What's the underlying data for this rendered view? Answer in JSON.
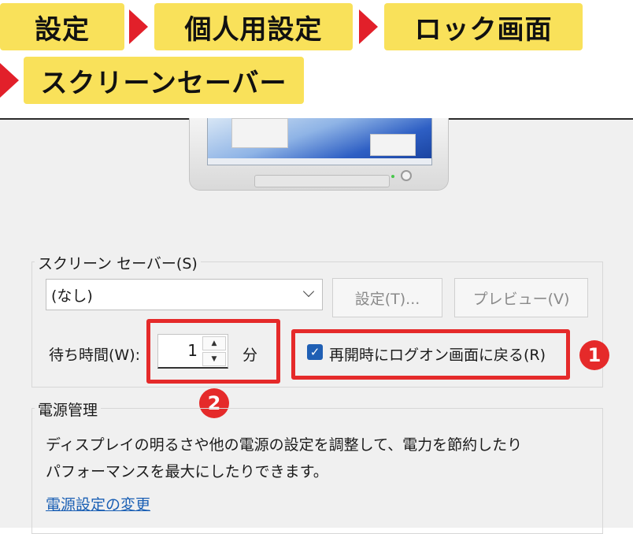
{
  "breadcrumb": {
    "items": [
      "設定",
      "個人用設定",
      "ロック画面",
      "スクリーンセーバー"
    ]
  },
  "colors": {
    "banner": "#f9e15a",
    "arrow": "#e2202a",
    "highlight": "#e52a2a",
    "checkbox": "#1f5fb4",
    "link": "#1a5fb4"
  },
  "screensaver": {
    "legend": "スクリーン セーバー(S)",
    "selected": "(なし)",
    "settings_button": "設定(T)...",
    "preview_button": "プレビュー(V)",
    "wait_label": "待ち時間(W):",
    "wait_value": "1",
    "wait_unit": "分",
    "resume_label": "再開時にログオン画面に戻る(R)",
    "resume_checked": true
  },
  "badges": {
    "one": "1",
    "two": "2"
  },
  "power": {
    "legend": "電源管理",
    "desc_line1": "ディスプレイの明るさや他の電源の設定を調整して、電力を節約したり",
    "desc_line2": "パフォーマンスを最大にしたりできます。",
    "link": "電源設定の変更"
  },
  "icons": {
    "dropdown": "chevron-down-icon",
    "spin_up": "triangle-up-icon",
    "spin_down": "triangle-down-icon",
    "check": "checkmark-icon"
  }
}
